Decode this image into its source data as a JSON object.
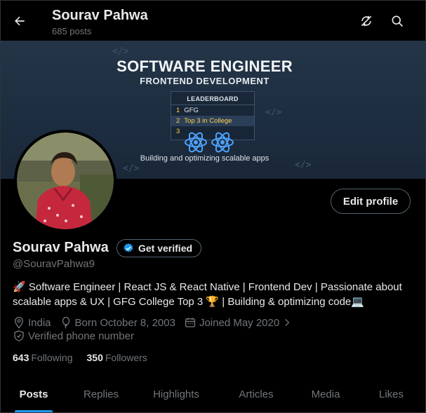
{
  "header": {
    "title": "Sourav Pahwa",
    "posts_count": "685 posts"
  },
  "banner": {
    "title": "SOFTWARE ENGINEER",
    "subtitle": "FRONTEND DEVELOPMENT",
    "leaderboard": {
      "heading": "LEADERBOARD",
      "rows": [
        {
          "rank": "1",
          "text": "GFG"
        },
        {
          "rank": "2",
          "text": "Top 3 in College"
        },
        {
          "rank": "3",
          "text": ""
        }
      ]
    },
    "tagline": "Building and optimizing scalable apps",
    "code_tag": "</>",
    "accent_color": "#4da3ff"
  },
  "profile": {
    "name": "Sourav Pahwa",
    "verify_label": "Get verified",
    "handle": "@SouravPahwa9",
    "bio_line1": "🚀 Software Engineer | React JS & React Native | Frontend Dev | Passionate about",
    "bio_line2": "scalable apps & UX | GFG College Top 3 🏆 | Building & optimizing code💻",
    "location": "India",
    "birthday": "Born October 8, 2003",
    "joined": "Joined May 2020",
    "phone": "Verified phone number",
    "following_count": "643",
    "following_label": "Following",
    "followers_count": "350",
    "followers_label": "Followers",
    "edit_label": "Edit profile"
  },
  "tabs": [
    {
      "label": "Posts"
    },
    {
      "label": "Replies"
    },
    {
      "label": "Highlights"
    },
    {
      "label": "Articles"
    },
    {
      "label": "Media"
    },
    {
      "label": "Likes"
    }
  ],
  "colors": {
    "accent": "#1d9bf0",
    "muted": "#71767b",
    "text": "#e7e9ea",
    "gold": "#ffd24a"
  }
}
